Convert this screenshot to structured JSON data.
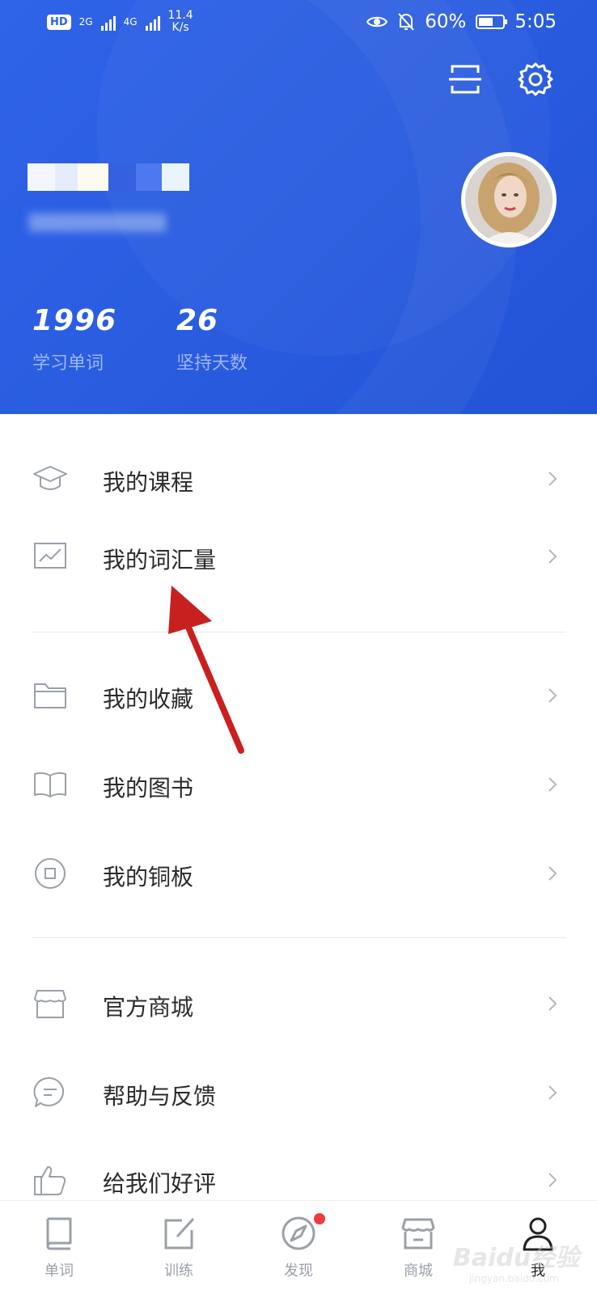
{
  "status_bar": {
    "hd_label": "HD",
    "net1": "2G",
    "net2": "4G",
    "speed": "11.4",
    "speed_unit": "K/s",
    "battery": "60%",
    "battery_level": 0.6,
    "time": "5:05"
  },
  "header": {
    "background_color": "#2f63e8",
    "scan_icon": "scan-icon",
    "settings_icon": "gear-icon",
    "stats": [
      {
        "value": "1996",
        "label": "学习单词"
      },
      {
        "value": "26",
        "label": "坚持天数"
      }
    ]
  },
  "menu": {
    "groups": [
      [
        {
          "label": "我的课程",
          "icon": "graduation-cap-icon"
        },
        {
          "label": "我的词汇量",
          "icon": "chart-icon"
        }
      ],
      [
        {
          "label": "我的收藏",
          "icon": "folder-icon"
        },
        {
          "label": "我的图书",
          "icon": "book-open-icon"
        },
        {
          "label": "我的铜板",
          "icon": "coin-icon"
        }
      ],
      [
        {
          "label": "官方商城",
          "icon": "store-icon"
        },
        {
          "label": "帮助与反馈",
          "icon": "feedback-icon"
        },
        {
          "label": "给我们好评",
          "icon": "thumbs-up-icon"
        }
      ]
    ]
  },
  "bottom_nav": {
    "items": [
      {
        "label": "单词",
        "icon": "book-icon"
      },
      {
        "label": "训练",
        "icon": "edit-icon"
      },
      {
        "label": "发现",
        "icon": "compass-icon"
      },
      {
        "label": "商城",
        "icon": "shop-icon"
      },
      {
        "label": "我",
        "icon": "user-icon"
      }
    ],
    "active_index": 4,
    "notification_dot_color": "#ee3b3b"
  },
  "watermark": {
    "text": "Baidu经验",
    "sub": "jingyan.baidu.com"
  }
}
